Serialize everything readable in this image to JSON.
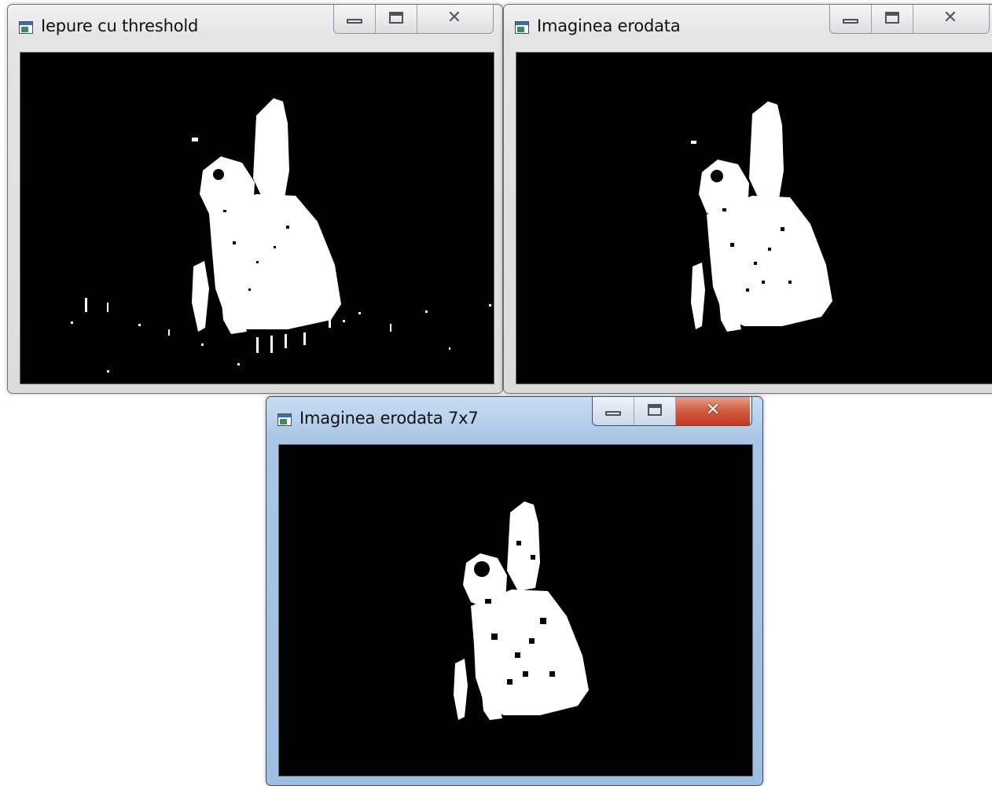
{
  "windows": [
    {
      "title": "Iepure cu threshold",
      "controls": {
        "minimize": "minimize",
        "maximize": "maximize",
        "close": "close"
      },
      "image": "rabbit silhouette after threshold"
    },
    {
      "title": "Imaginea erodata",
      "controls": {
        "minimize": "minimize",
        "maximize": "maximize",
        "close": "close"
      },
      "image": "rabbit silhouette after erosion"
    },
    {
      "title": "Imaginea erodata 7x7",
      "controls": {
        "minimize": "minimize",
        "maximize": "maximize",
        "close": "close"
      },
      "image": "rabbit silhouette after 7x7 erosion"
    }
  ],
  "colors": {
    "canvas_background": "#000000",
    "foreground": "#ffffff",
    "active_title_bar": "#b8d1ec",
    "close_button_active": "#c94a33"
  }
}
